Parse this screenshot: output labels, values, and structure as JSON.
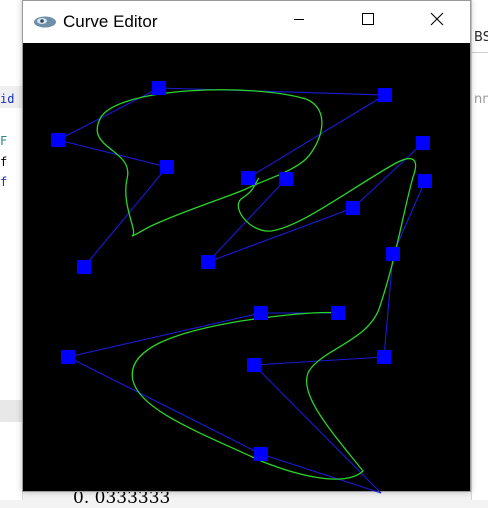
{
  "window": {
    "title": "Curve Editor",
    "icon": "app-logo-icon",
    "controls": {
      "minimize": "minimize-icon",
      "maximize": "maximize-icon",
      "close": "close-icon"
    }
  },
  "background": {
    "left_code": [
      "id",
      "F",
      "f",
      "f"
    ],
    "right_tab": "BS",
    "right_text": "nn",
    "bottom_text": "0. 0333333"
  },
  "colors": {
    "canvas": "#000000",
    "curve": "#2bd32b",
    "control_polygon": "#1a1ad8",
    "control_point": "#0000ff"
  }
}
